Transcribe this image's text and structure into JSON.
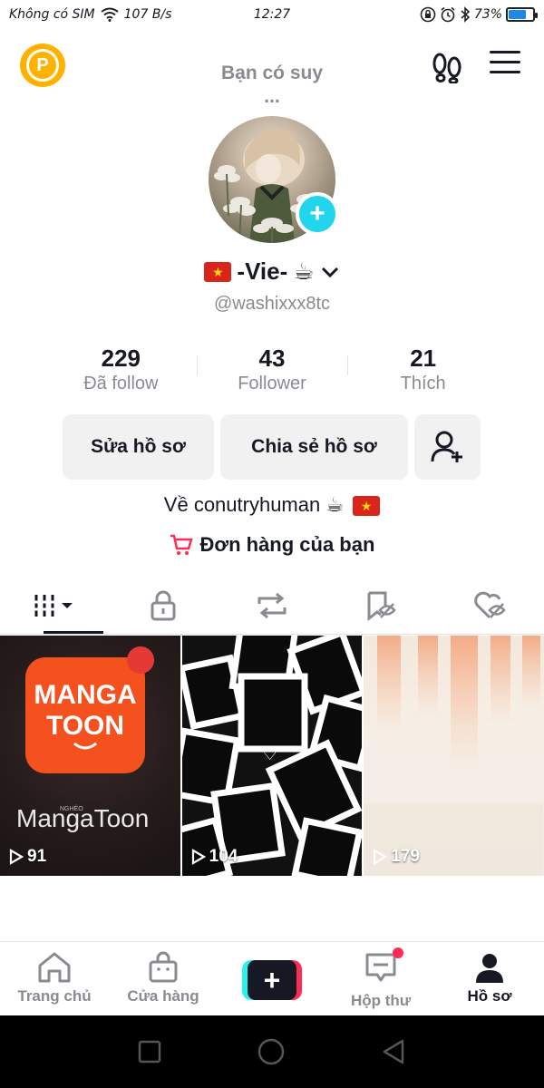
{
  "status_bar": {
    "carrier": "Không có SIM",
    "speed": "107 B/s",
    "time": "12:27",
    "battery": "73%",
    "battery_level": 0.73
  },
  "header": {
    "coin_letter": "P",
    "note": "Bạn có suy ..."
  },
  "profile": {
    "flag_star": "★",
    "display_name": "-Vie-",
    "name_emoji": "☕",
    "handle": "@washixxx8tc",
    "add_symbol": "+"
  },
  "stats": [
    {
      "value": "229",
      "label": "Đã follow"
    },
    {
      "value": "43",
      "label": "Follower"
    },
    {
      "value": "21",
      "label": "Thích"
    }
  ],
  "buttons": {
    "edit": "Sửa hồ sơ",
    "share": "Chia sẻ hồ sơ"
  },
  "bio": "Về conutryhuman ☕",
  "orders_label": "Đơn hàng của bạn",
  "tabs": [
    "videos-icon",
    "lock-icon",
    "repost-icon",
    "bookmark-eye-icon",
    "liked-hidden-icon"
  ],
  "videos": [
    {
      "views": "91",
      "title_line1": "MANGA",
      "title_line2": "TOON",
      "brand": "MangaToon",
      "small": "NGHÉO"
    },
    {
      "views": "104",
      "symbol": "♡"
    },
    {
      "views": "179"
    }
  ],
  "bottom_nav": [
    {
      "label": "Trang chủ",
      "icon": "home-icon"
    },
    {
      "label": "Cửa hàng",
      "icon": "shop-icon"
    },
    {
      "label": "",
      "icon": "create-icon",
      "symbol": "+"
    },
    {
      "label": "Hộp thư",
      "icon": "inbox-icon"
    },
    {
      "label": "Hồ sơ",
      "icon": "profile-icon"
    }
  ],
  "colors": {
    "accent_cyan": "#20d5ec",
    "accent_red": "#fe2c55",
    "coin": "#ffb300",
    "flag_red": "#da251d"
  }
}
